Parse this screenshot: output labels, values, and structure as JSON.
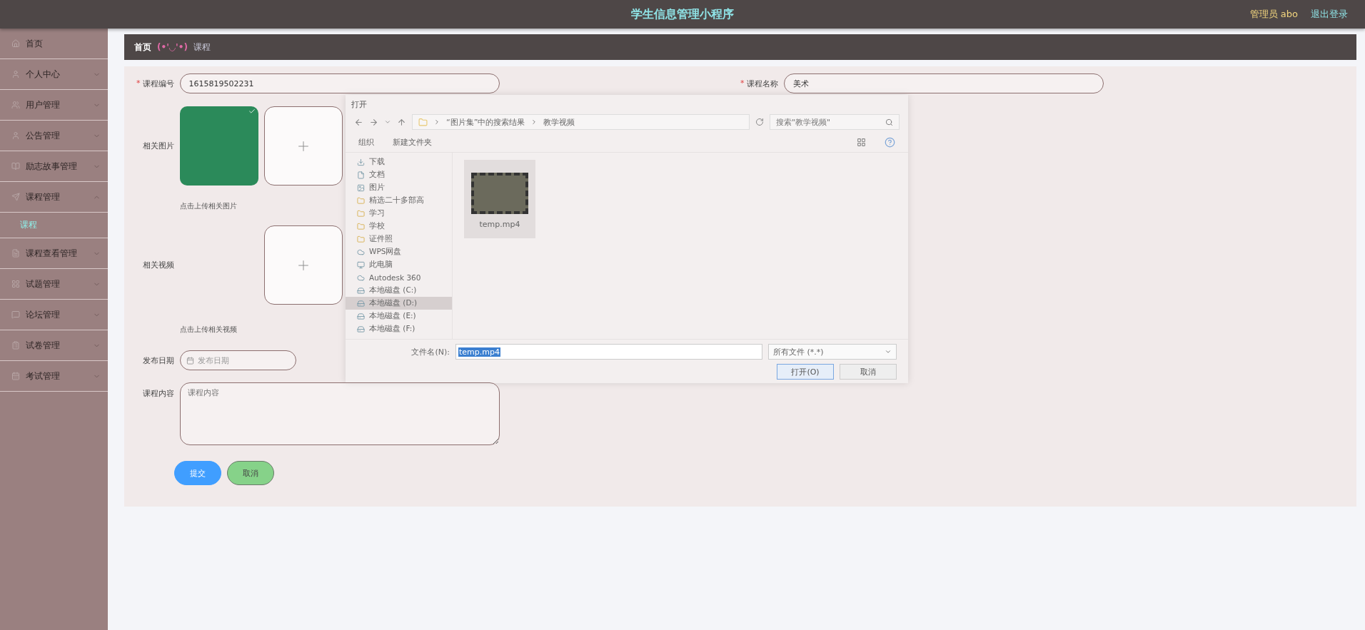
{
  "header": {
    "title": "学生信息管理小程序",
    "user": "管理员 abo",
    "logout": "退出登录"
  },
  "sidebar": {
    "items": [
      {
        "label": "首页"
      },
      {
        "label": "个人中心",
        "expanded": false
      },
      {
        "label": "用户管理",
        "expanded": false
      },
      {
        "label": "公告管理",
        "expanded": false
      },
      {
        "label": "励志故事管理",
        "expanded": false
      },
      {
        "label": "课程管理",
        "expanded": true,
        "children": [
          {
            "label": "课程",
            "selected": true
          }
        ]
      },
      {
        "label": "课程查看管理",
        "expanded": false
      },
      {
        "label": "试题管理",
        "expanded": false
      },
      {
        "label": "论坛管理",
        "expanded": false
      },
      {
        "label": "试卷管理",
        "expanded": false
      },
      {
        "label": "考试管理",
        "expanded": false
      }
    ]
  },
  "breadcrumb": [
    {
      "kind": "link",
      "text": "首页"
    },
    {
      "kind": "emoticon",
      "text": "(•'◡'•)"
    },
    {
      "kind": "current",
      "text": "课程"
    }
  ],
  "form": {
    "fields": [
      {
        "kind": "text",
        "label": "课程编号",
        "mark": "*",
        "value": "1615819502231"
      },
      {
        "kind": "text",
        "label": "课程名称",
        "mark": "*",
        "value": "美术"
      },
      {
        "kind": "image",
        "label": "相关图片",
        "hint": "点击上传相关图片"
      },
      {
        "kind": "video",
        "label": "相关视频",
        "hint": "点击上传相关视频"
      },
      {
        "kind": "date",
        "label": "发布日期",
        "placeholder": "发布日期"
      },
      {
        "kind": "textarea",
        "label": "课程内容",
        "placeholder": "课程内容"
      }
    ],
    "buttons": [
      {
        "kind": "primary",
        "label": "提交"
      },
      {
        "kind": "secondary",
        "label": "取消"
      }
    ]
  },
  "file_dialog": {
    "title": "打开",
    "path": [
      "“图片集”中的搜索结果",
      "教学视频"
    ],
    "search_placeholder": "搜索\"教学视频\"",
    "toolbar": [
      "组织",
      "新建文件夹"
    ],
    "nav": [
      {
        "label": "下载",
        "selected": false
      },
      {
        "label": "文档",
        "selected": false
      },
      {
        "label": "图片",
        "selected": false
      },
      {
        "label": "精选二十多部高",
        "selected": false
      },
      {
        "label": "学习",
        "selected": false
      },
      {
        "label": "学校",
        "selected": false
      },
      {
        "label": "证件照",
        "selected": false
      },
      {
        "label": "WPS网盘",
        "selected": false
      },
      {
        "label": "此电脑",
        "selected": false
      },
      {
        "label": "Autodesk 360",
        "selected": false
      },
      {
        "label": "本地磁盘 (C:)",
        "selected": false
      },
      {
        "label": "本地磁盘 (D:)",
        "selected": true
      },
      {
        "label": "本地磁盘 (E:)",
        "selected": false
      },
      {
        "label": "本地磁盘 (F:)",
        "selected": false
      }
    ],
    "files": [
      "temp.mp4"
    ],
    "filename_label": "文件名(N):",
    "filename": "temp.mp4",
    "filetype": "所有文件 (*.*)",
    "buttons": [
      "打开(O)",
      "取消"
    ]
  }
}
